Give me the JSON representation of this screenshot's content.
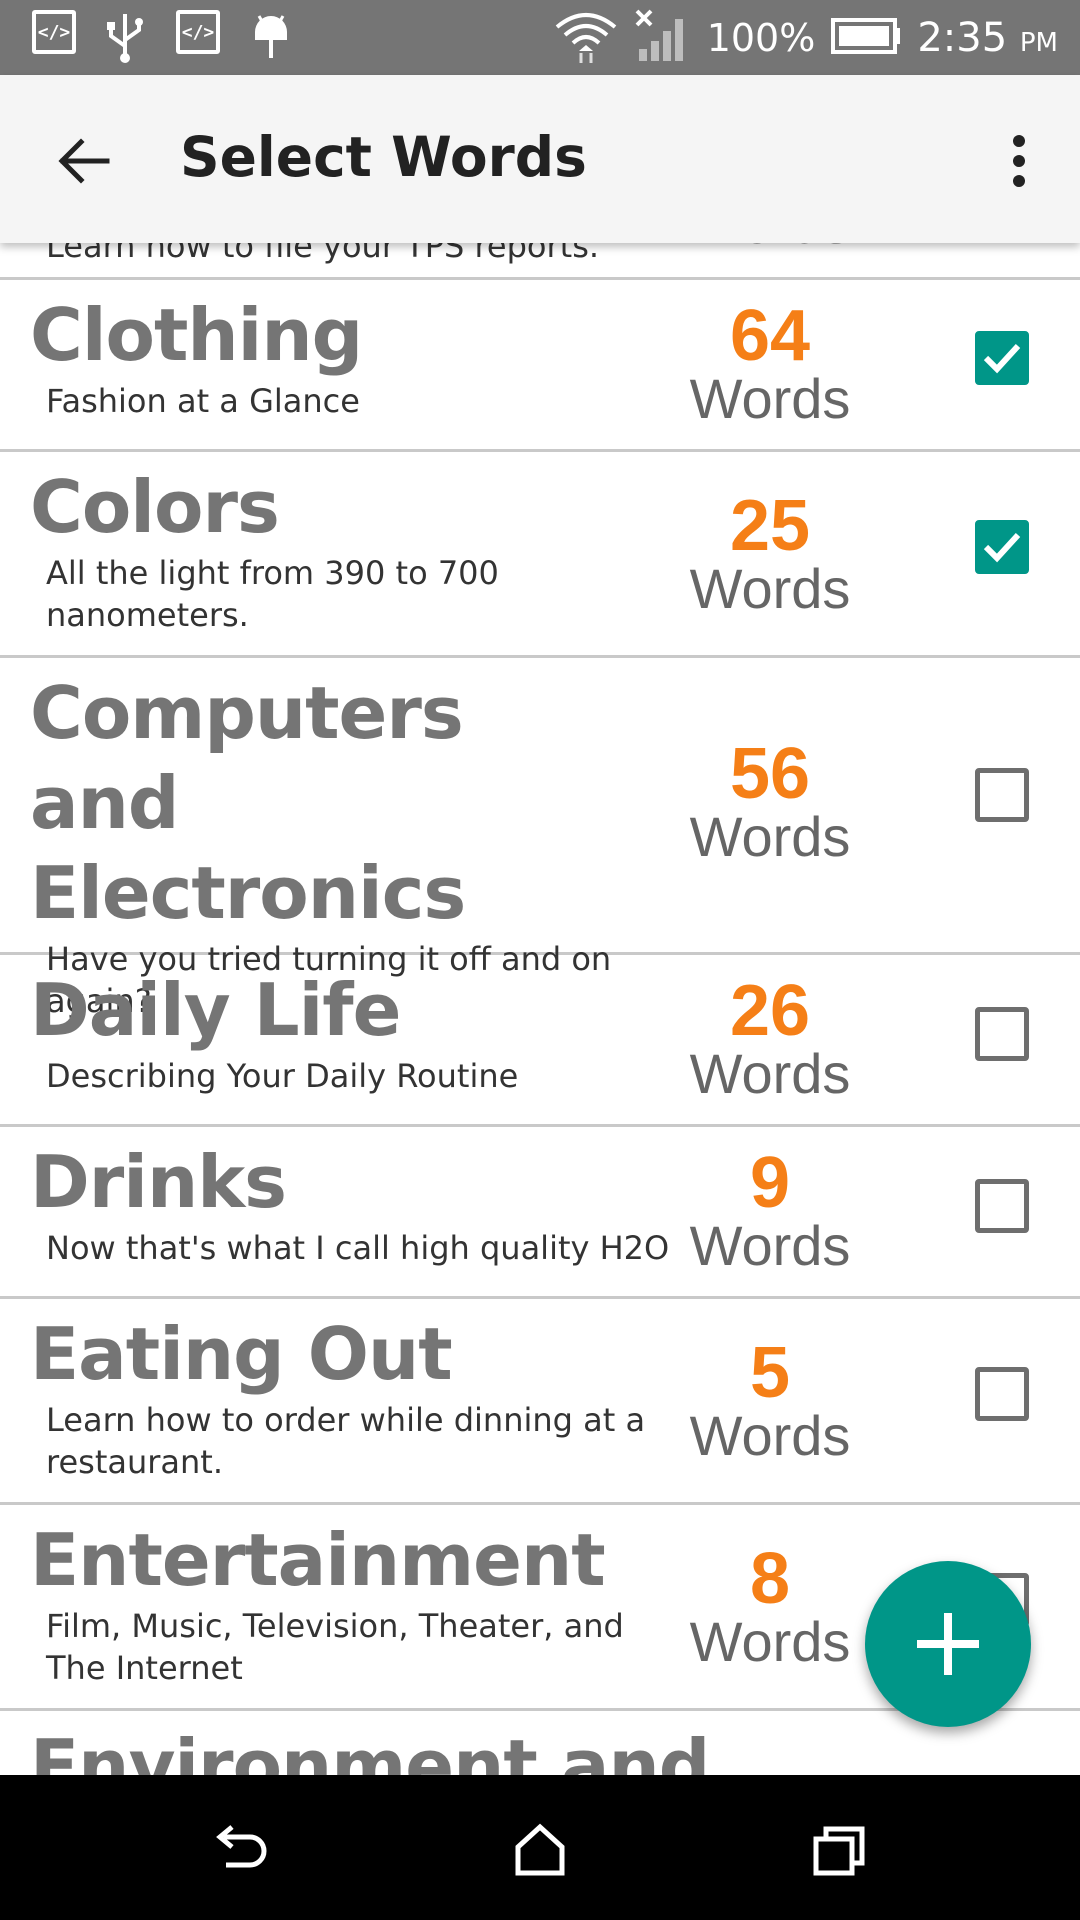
{
  "status_bar": {
    "battery_percent": "100%",
    "time": "2:35",
    "ampm": "PM",
    "icons": [
      "code-icon",
      "usb-icon",
      "code-icon",
      "android-icon",
      "wifi-icon",
      "signal-icon",
      "battery-icon"
    ]
  },
  "app_bar": {
    "title": "Select Words",
    "back_icon": "arrow-back-icon",
    "menu_icon": "more-vert-icon"
  },
  "partial_top": {
    "desc": "Learn how to file your TPS reports.",
    "count_label": "Words"
  },
  "categories": [
    {
      "title": "Clothing",
      "desc": "Fashion at a Glance",
      "count": "64",
      "count_label": "Words",
      "checked": true
    },
    {
      "title": "Colors",
      "desc": "All the light from 390 to 700 nanometers.",
      "count": "25",
      "count_label": "Words",
      "checked": true
    },
    {
      "title": "Computers and Electronics",
      "desc": "Have you tried turning it off and on again?",
      "count": "56",
      "count_label": "Words",
      "checked": false
    },
    {
      "title": "Daily Life",
      "desc": "Describing Your Daily Routine",
      "count": "26",
      "count_label": "Words",
      "checked": false
    },
    {
      "title": "Drinks",
      "desc": "Now that's what I call high quality H2O",
      "count": "9",
      "count_label": "Words",
      "checked": false
    },
    {
      "title": "Eating Out",
      "desc": "Learn how to order while dinning at a restaurant.",
      "count": "5",
      "count_label": "Words",
      "checked": false
    },
    {
      "title": "Entertainment",
      "desc": "Film, Music, Television, Theater, and The Internet",
      "count": "8",
      "count_label": "Words",
      "checked": false
    }
  ],
  "partial_bottom": {
    "title": "Environment and"
  },
  "fab": {
    "icon": "plus-icon"
  },
  "colors": {
    "accent": "#009688",
    "count": "#f57f17",
    "title_gray": "#757575"
  },
  "nav_bar": {
    "icons": [
      "back-icon",
      "home-icon",
      "recents-icon"
    ]
  }
}
